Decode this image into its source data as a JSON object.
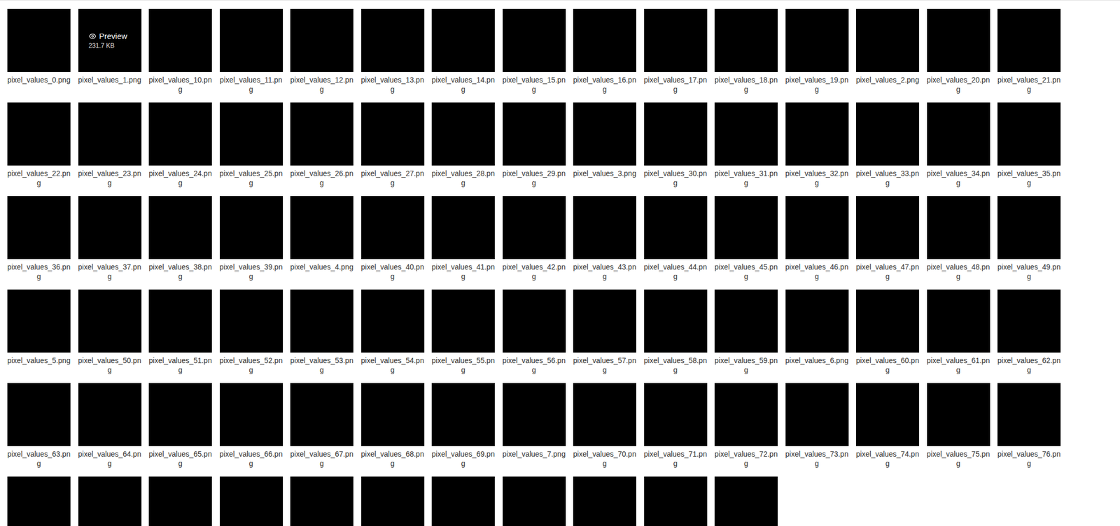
{
  "thumbnails": [
    {
      "caption": "pixel_values_0.png",
      "hovered": false
    },
    {
      "caption": "pixel_values_1.png",
      "hovered": true,
      "preview": {
        "label": "Preview",
        "size": "231.7 KB"
      }
    },
    {
      "caption": "pixel_values_10.png",
      "hovered": false
    },
    {
      "caption": "pixel_values_11.png",
      "hovered": false
    },
    {
      "caption": "pixel_values_12.png",
      "hovered": false
    },
    {
      "caption": "pixel_values_13.png",
      "hovered": false
    },
    {
      "caption": "pixel_values_14.png",
      "hovered": false
    },
    {
      "caption": "pixel_values_15.png",
      "hovered": false
    },
    {
      "caption": "pixel_values_16.png",
      "hovered": false
    },
    {
      "caption": "pixel_values_17.png",
      "hovered": false
    },
    {
      "caption": "pixel_values_18.png",
      "hovered": false
    },
    {
      "caption": "pixel_values_19.png",
      "hovered": false
    },
    {
      "caption": "pixel_values_2.png",
      "hovered": false
    },
    {
      "caption": "pixel_values_20.png",
      "hovered": false
    },
    {
      "caption": "pixel_values_21.png",
      "hovered": false
    },
    {
      "caption": "pixel_values_22.png",
      "hovered": false
    },
    {
      "caption": "pixel_values_23.png",
      "hovered": false
    },
    {
      "caption": "pixel_values_24.png",
      "hovered": false
    },
    {
      "caption": "pixel_values_25.png",
      "hovered": false
    },
    {
      "caption": "pixel_values_26.png",
      "hovered": false
    },
    {
      "caption": "pixel_values_27.png",
      "hovered": false
    },
    {
      "caption": "pixel_values_28.png",
      "hovered": false
    },
    {
      "caption": "pixel_values_29.png",
      "hovered": false
    },
    {
      "caption": "pixel_values_3.png",
      "hovered": false
    },
    {
      "caption": "pixel_values_30.png",
      "hovered": false
    },
    {
      "caption": "pixel_values_31.png",
      "hovered": false
    },
    {
      "caption": "pixel_values_32.png",
      "hovered": false
    },
    {
      "caption": "pixel_values_33.png",
      "hovered": false
    },
    {
      "caption": "pixel_values_34.png",
      "hovered": false
    },
    {
      "caption": "pixel_values_35.png",
      "hovered": false
    },
    {
      "caption": "pixel_values_36.png",
      "hovered": false
    },
    {
      "caption": "pixel_values_37.png",
      "hovered": false
    },
    {
      "caption": "pixel_values_38.png",
      "hovered": false
    },
    {
      "caption": "pixel_values_39.png",
      "hovered": false
    },
    {
      "caption": "pixel_values_4.png",
      "hovered": false
    },
    {
      "caption": "pixel_values_40.png",
      "hovered": false
    },
    {
      "caption": "pixel_values_41.png",
      "hovered": false
    },
    {
      "caption": "pixel_values_42.png",
      "hovered": false
    },
    {
      "caption": "pixel_values_43.png",
      "hovered": false
    },
    {
      "caption": "pixel_values_44.png",
      "hovered": false
    },
    {
      "caption": "pixel_values_45.png",
      "hovered": false
    },
    {
      "caption": "pixel_values_46.png",
      "hovered": false
    },
    {
      "caption": "pixel_values_47.png",
      "hovered": false
    },
    {
      "caption": "pixel_values_48.png",
      "hovered": false
    },
    {
      "caption": "pixel_values_49.png",
      "hovered": false
    },
    {
      "caption": "pixel_values_5.png",
      "hovered": false
    },
    {
      "caption": "pixel_values_50.png",
      "hovered": false
    },
    {
      "caption": "pixel_values_51.png",
      "hovered": false
    },
    {
      "caption": "pixel_values_52.png",
      "hovered": false
    },
    {
      "caption": "pixel_values_53.png",
      "hovered": false
    },
    {
      "caption": "pixel_values_54.png",
      "hovered": false
    },
    {
      "caption": "pixel_values_55.png",
      "hovered": false
    },
    {
      "caption": "pixel_values_56.png",
      "hovered": false
    },
    {
      "caption": "pixel_values_57.png",
      "hovered": false
    },
    {
      "caption": "pixel_values_58.png",
      "hovered": false
    },
    {
      "caption": "pixel_values_59.png",
      "hovered": false
    },
    {
      "caption": "pixel_values_6.png",
      "hovered": false
    },
    {
      "caption": "pixel_values_60.png",
      "hovered": false
    },
    {
      "caption": "pixel_values_61.png",
      "hovered": false
    },
    {
      "caption": "pixel_values_62.png",
      "hovered": false
    },
    {
      "caption": "pixel_values_63.png",
      "hovered": false
    },
    {
      "caption": "pixel_values_64.png",
      "hovered": false
    },
    {
      "caption": "pixel_values_65.png",
      "hovered": false
    },
    {
      "caption": "pixel_values_66.png",
      "hovered": false
    },
    {
      "caption": "pixel_values_67.png",
      "hovered": false
    },
    {
      "caption": "pixel_values_68.png",
      "hovered": false
    },
    {
      "caption": "pixel_values_69.png",
      "hovered": false
    },
    {
      "caption": "pixel_values_7.png",
      "hovered": false
    },
    {
      "caption": "pixel_values_70.png",
      "hovered": false
    },
    {
      "caption": "pixel_values_71.png",
      "hovered": false
    },
    {
      "caption": "pixel_values_72.png",
      "hovered": false
    },
    {
      "caption": "pixel_values_73.png",
      "hovered": false
    },
    {
      "caption": "pixel_values_74.png",
      "hovered": false
    },
    {
      "caption": "pixel_values_75.png",
      "hovered": false
    },
    {
      "caption": "pixel_values_76.png",
      "hovered": false
    },
    {
      "caption": "",
      "hovered": false
    },
    {
      "caption": "",
      "hovered": false
    },
    {
      "caption": "",
      "hovered": false
    },
    {
      "caption": "",
      "hovered": false
    },
    {
      "caption": "",
      "hovered": false
    },
    {
      "caption": "",
      "hovered": false
    },
    {
      "caption": "",
      "hovered": false
    },
    {
      "caption": "",
      "hovered": false
    },
    {
      "caption": "",
      "hovered": false
    },
    {
      "caption": "",
      "hovered": false
    },
    {
      "caption": "",
      "hovered": false
    }
  ]
}
